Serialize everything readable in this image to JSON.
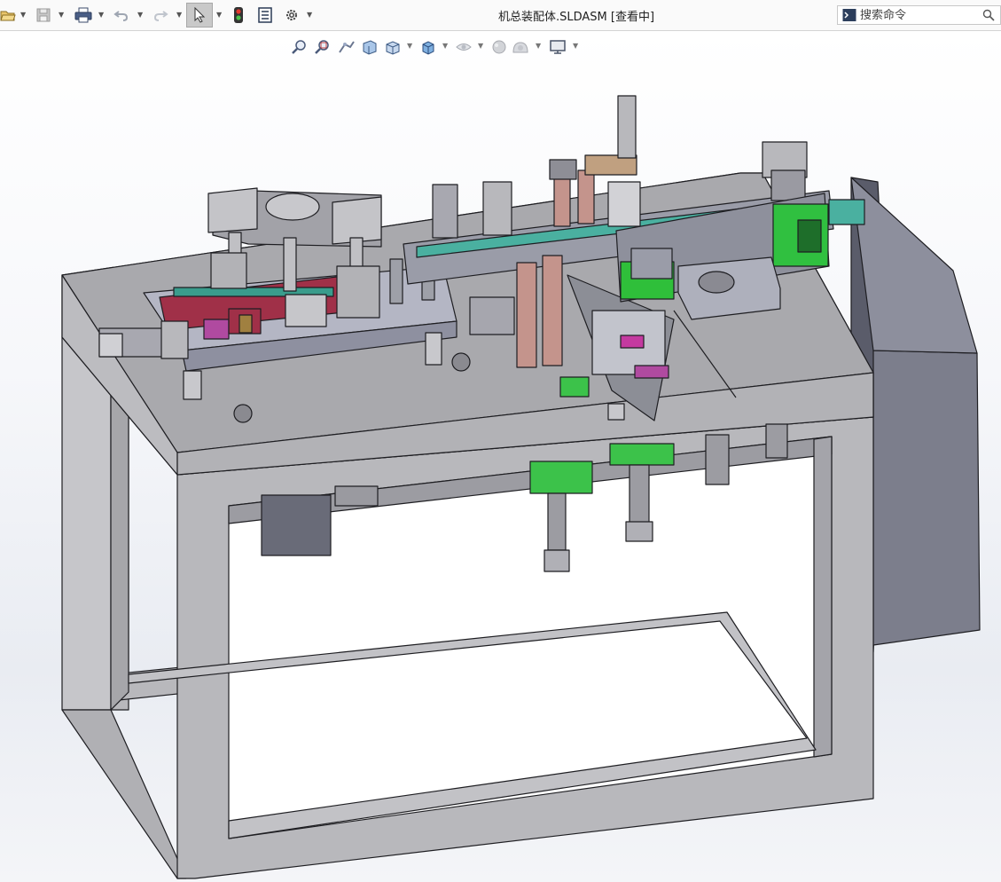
{
  "window": {
    "title": "机总装配体.SLDASM [查看中]"
  },
  "toolbar": {
    "items": [
      {
        "name": "open-icon"
      },
      {
        "name": "save-icon"
      },
      {
        "name": "print-icon"
      },
      {
        "name": "undo-icon"
      },
      {
        "name": "redo-icon"
      },
      {
        "name": "select-icon"
      },
      {
        "name": "rebuild-traffic-light-icon"
      },
      {
        "name": "file-properties-icon"
      },
      {
        "name": "options-gear-icon"
      }
    ]
  },
  "search": {
    "placeholder": "搜索命令"
  },
  "heads_up_toolbar": {
    "items": [
      {
        "name": "zoom-to-fit-icon"
      },
      {
        "name": "zoom-to-area-icon"
      },
      {
        "name": "previous-view-icon"
      },
      {
        "name": "section-view-icon"
      },
      {
        "name": "view-orientation-icon"
      },
      {
        "name": "display-style-icon"
      },
      {
        "name": "hide-show-items-icon"
      },
      {
        "name": "edit-appearance-icon"
      },
      {
        "name": "apply-scene-icon"
      },
      {
        "name": "view-settings-icon"
      }
    ]
  },
  "colors": {
    "frame": "#b8b8bc",
    "table_top": "#a9a9ad",
    "cabinet": "#7c7e8c",
    "green_parts": "#2fbf3a",
    "red_parts": "#a0304a",
    "magenta_parts": "#b04aa0",
    "copper_rods": "#c4948c"
  }
}
